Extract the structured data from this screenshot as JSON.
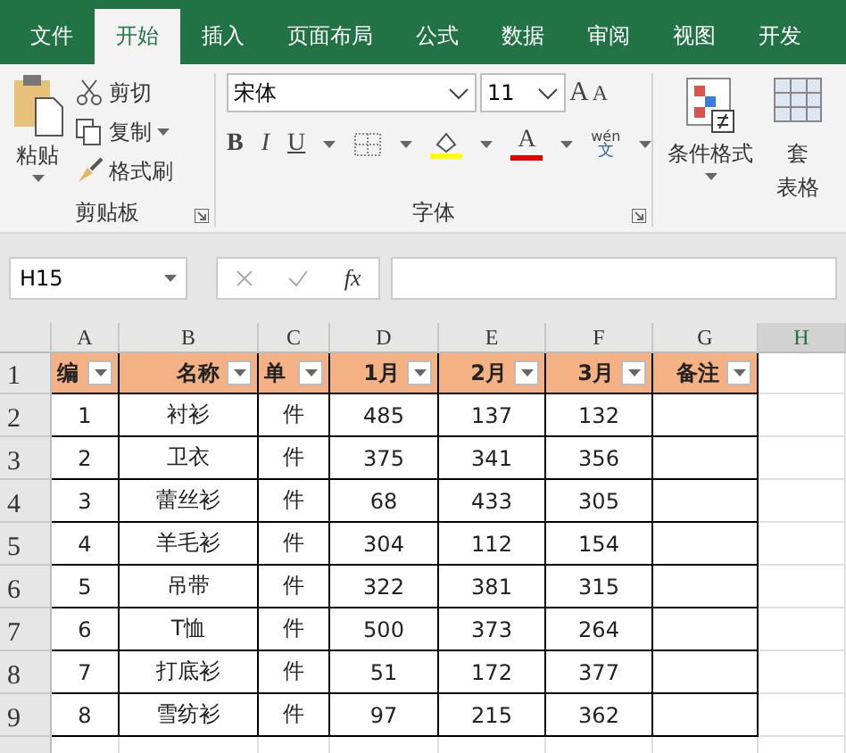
{
  "tabs": [
    {
      "label": "文件",
      "selected": false
    },
    {
      "label": "开始",
      "selected": true
    },
    {
      "label": "插入",
      "selected": false
    },
    {
      "label": "页面布局",
      "selected": false
    },
    {
      "label": "公式",
      "selected": false
    },
    {
      "label": "数据",
      "selected": false
    },
    {
      "label": "审阅",
      "selected": false
    },
    {
      "label": "视图",
      "selected": false
    },
    {
      "label": "开发",
      "selected": false
    }
  ],
  "clipboard": {
    "paste": "粘贴",
    "cut": "剪切",
    "copy": "复制",
    "painter": "格式刷",
    "label": "剪贴板"
  },
  "font": {
    "name": "宋体",
    "size": "11",
    "grow": "A",
    "shrink": "A",
    "font_color": "A",
    "bold": "B",
    "italic": "I",
    "underline": "U",
    "phonetic_top": "wén",
    "phonetic_bottom": "文",
    "label": "字体"
  },
  "styles": {
    "conditional": "条件格式",
    "table_top": "套",
    "table_bottom": "表格"
  },
  "formula_bar": {
    "name_box": "H15",
    "fx": "fx"
  },
  "sheet": {
    "columns": [
      "A",
      "B",
      "C",
      "D",
      "E",
      "F",
      "G",
      "H"
    ],
    "rows": [
      {
        "number": "1",
        "kind": "header",
        "cells": [
          "编",
          "名称",
          "单",
          "1月",
          "2月",
          "3月",
          "备注"
        ]
      },
      {
        "number": "2",
        "kind": "data",
        "cells": [
          "1",
          "衬衫",
          "件",
          "485",
          "137",
          "132",
          ""
        ]
      },
      {
        "number": "3",
        "kind": "data",
        "cells": [
          "2",
          "卫衣",
          "件",
          "375",
          "341",
          "356",
          ""
        ]
      },
      {
        "number": "4",
        "kind": "data",
        "cells": [
          "3",
          "蕾丝衫",
          "件",
          "68",
          "433",
          "305",
          ""
        ]
      },
      {
        "number": "5",
        "kind": "data",
        "cells": [
          "4",
          "羊毛衫",
          "件",
          "304",
          "112",
          "154",
          ""
        ]
      },
      {
        "number": "6",
        "kind": "data",
        "cells": [
          "5",
          "吊带",
          "件",
          "322",
          "381",
          "315",
          ""
        ]
      },
      {
        "number": "7",
        "kind": "data",
        "cells": [
          "6",
          "T恤",
          "件",
          "500",
          "373",
          "264",
          ""
        ]
      },
      {
        "number": "8",
        "kind": "data",
        "cells": [
          "7",
          "打底衫",
          "件",
          "51",
          "172",
          "377",
          ""
        ]
      },
      {
        "number": "9",
        "kind": "data",
        "cells": [
          "8",
          "雪纺衫",
          "件",
          "97",
          "215",
          "362",
          ""
        ]
      }
    ]
  }
}
